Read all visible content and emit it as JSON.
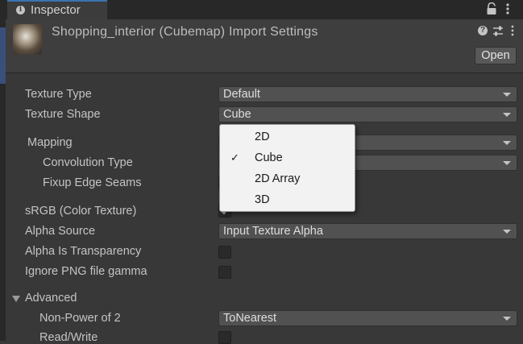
{
  "tab": {
    "title": "Inspector"
  },
  "header": {
    "title": "Shopping_interior (Cubemap) Import Settings",
    "open_label": "Open"
  },
  "rows": {
    "texture_type": {
      "label": "Texture Type",
      "value": "Default"
    },
    "texture_shape": {
      "label": "Texture Shape",
      "value": "Cube"
    },
    "mapping": {
      "label": "Mapping"
    },
    "convolution_type": {
      "label": "Convolution Type"
    },
    "fixup_edge_seams": {
      "label": "Fixup Edge Seams"
    },
    "srgb": {
      "label": "sRGB (Color Texture)",
      "checked": true
    },
    "alpha_source": {
      "label": "Alpha Source",
      "value": "Input Texture Alpha"
    },
    "alpha_is_transparency": {
      "label": "Alpha Is Transparency",
      "checked": false
    },
    "ignore_png_gamma": {
      "label": "Ignore PNG file gamma",
      "checked": false
    },
    "advanced": {
      "label": "Advanced",
      "expanded": true
    },
    "non_power_of_2": {
      "label": "Non-Power of 2",
      "value": "ToNearest"
    },
    "read_write": {
      "label": "Read/Write",
      "checked": false
    }
  },
  "popup": {
    "options": [
      "2D",
      "Cube",
      "2D Array",
      "3D"
    ],
    "selected": "Cube"
  },
  "colors": {
    "background": "#383838",
    "header": "#3e3e3e",
    "popup_bg": "#f2f2f2",
    "accent": "#3a72b0"
  }
}
